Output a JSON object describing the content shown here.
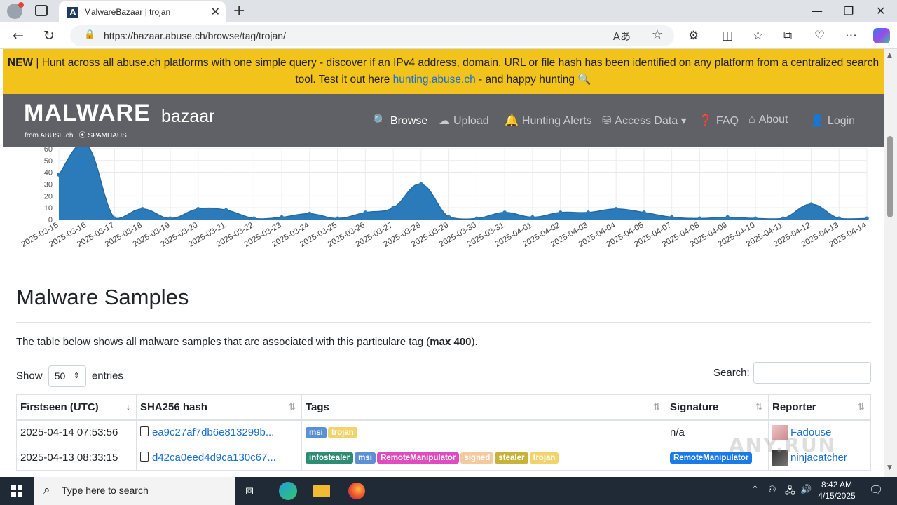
{
  "browser": {
    "tab_title": "MalwareBazaar | trojan",
    "url": "https://bazaar.abuse.ch/browse/tag/trojan/"
  },
  "banner": {
    "new_label": "NEW",
    "text_1": " | Hunt across all abuse.ch platforms with one simple query - discover if an IPv4 address, domain, URL or file hash has been identified on any platform from a centralized search tool. Test it out here ",
    "link": "hunting.abuse.ch",
    "text_2": " - and happy hunting 🔍"
  },
  "logo": {
    "main": "MALWARE",
    "sub": "bazaar",
    "from": "from ABUSE.ch | ⦿ SPAMHAUS"
  },
  "nav": {
    "items": [
      {
        "label": "Browse",
        "icon": "search-icon",
        "glyph": "🔍"
      },
      {
        "label": "Upload",
        "icon": "cloud-upload-icon",
        "glyph": "☁"
      },
      {
        "label": "Hunting Alerts",
        "icon": "bell-icon",
        "glyph": "🔔"
      },
      {
        "label": "Access Data ▾",
        "icon": "database-icon",
        "glyph": "⛁"
      },
      {
        "label": "FAQ",
        "icon": "question-circle-icon",
        "glyph": "❓"
      },
      {
        "label": "About",
        "icon": "building-icon",
        "glyph": "⌂"
      },
      {
        "label": "Login",
        "icon": "user-icon",
        "glyph": "👤"
      }
    ]
  },
  "chart_data": {
    "type": "area",
    "color": "#2b7bba",
    "x": [
      "2025-03-15",
      "2025-03-16",
      "2025-03-17",
      "2025-03-18",
      "2025-03-19",
      "2025-03-20",
      "2025-03-21",
      "2025-03-22",
      "2025-03-23",
      "2025-03-24",
      "2025-03-25",
      "2025-03-26",
      "2025-03-27",
      "2025-03-28",
      "2025-03-29",
      "2025-03-30",
      "2025-03-31",
      "2025-04-01",
      "2025-04-02",
      "2025-04-03",
      "2025-04-04",
      "2025-04-05",
      "2025-04-07",
      "2025-04-08",
      "2025-04-09",
      "2025-04-10",
      "2025-04-11",
      "2025-04-12",
      "2025-04-13",
      "2025-04-14"
    ],
    "values": [
      38,
      63,
      1,
      9,
      1,
      9,
      8,
      1,
      2,
      5,
      1,
      6,
      10,
      30,
      2,
      1,
      6,
      2,
      6,
      6,
      9,
      6,
      2,
      1,
      2,
      1,
      1,
      13,
      1,
      1
    ],
    "yticks": [
      0,
      10,
      20,
      30,
      40,
      50,
      60
    ],
    "ylim": [
      0,
      60
    ],
    "grid": true
  },
  "section": {
    "title": "Malware Samples",
    "desc_1": "The table below shows all malware samples that are associated with this particulare tag (",
    "desc_bold": "max 400",
    "desc_2": ")."
  },
  "controls": {
    "show_label": "Show",
    "entries_value": "50",
    "entries_label": "entries",
    "search_label": "Search:"
  },
  "table": {
    "columns": [
      "Firstseen (UTC)",
      "SHA256 hash",
      "Tags",
      "Signature",
      "Reporter"
    ],
    "rows": [
      {
        "firstseen": "2025-04-14 07:53:56",
        "hash": "ea9c27af7db6e813299b...",
        "tags": [
          {
            "t": "msi",
            "c": "#5b8fd6"
          },
          {
            "t": "trojan",
            "c": "#f2d36b"
          }
        ],
        "signature": "n/a",
        "signature_badge": false,
        "reporter": "Fadouse"
      },
      {
        "firstseen": "2025-04-13 08:33:15",
        "hash": "d42ca0eed4d9ca130c67...",
        "tags": [
          {
            "t": "infostealer",
            "c": "#2e8b74"
          },
          {
            "t": "msi",
            "c": "#5b8fd6"
          },
          {
            "t": "RemoteManipulator",
            "c": "#e04bc0"
          },
          {
            "t": "signed",
            "c": "#f5c9a0"
          },
          {
            "t": "stealer",
            "c": "#c7b23a"
          },
          {
            "t": "trojan",
            "c": "#f2d36b"
          }
        ],
        "signature": "RemoteManipulator",
        "signature_badge": true,
        "reporter": "ninjacatcher"
      }
    ]
  },
  "watermark": "ANY.RUN",
  "taskbar": {
    "search_placeholder": "Type here to search",
    "time": "8:42 AM",
    "date": "4/15/2025"
  }
}
